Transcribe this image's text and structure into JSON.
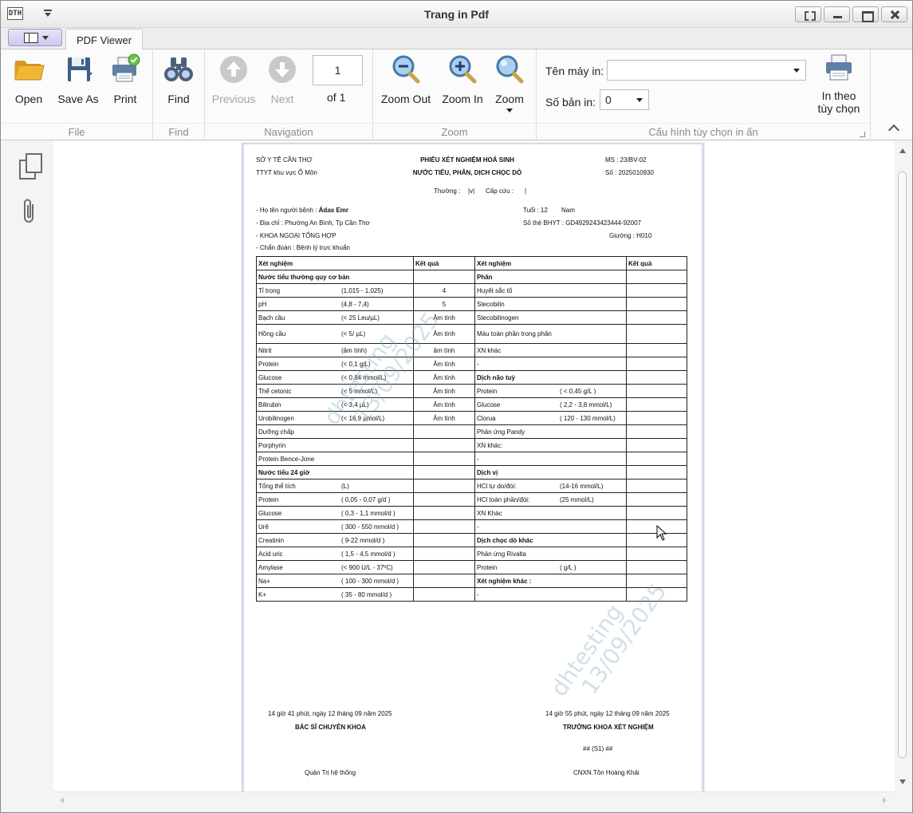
{
  "window": {
    "logo_text": "DTH",
    "title": "Trang in Pdf"
  },
  "tabs": {
    "pdf_viewer": "PDF Viewer"
  },
  "ribbon": {
    "file": {
      "label": "File",
      "open": "Open",
      "save_as": "Save As",
      "print": "Print"
    },
    "find": {
      "label": "Find",
      "find": "Find"
    },
    "navigation": {
      "label": "Navigation",
      "previous": "Previous",
      "next": "Next",
      "page_number": "1",
      "of_pages": "of 1"
    },
    "zoom": {
      "label": "Zoom",
      "zoom_out": "Zoom Out",
      "zoom_in": "Zoom In",
      "zoom": "Zoom"
    },
    "print_config": {
      "label": "Cấu hình tùy chọn in ấn",
      "printer_label": "Tên máy in:",
      "printer_value": "",
      "copies_label": "Số bản in:",
      "copies_value": "0",
      "custom_print_line1": "In theo",
      "custom_print_line2": "tùy chọn"
    }
  },
  "document": {
    "header": {
      "org1": "SỞ Y TẾ CẦN THƠ",
      "org2": "TTYT khu vực Ô Môn",
      "title1": "PHIẾU XÉT NGHIỆM HOÁ SINH",
      "title2": "NƯỚC TIỂU, PHÂN, DỊCH CHỌC DÒ",
      "ms": "MS : 23/BV-02",
      "so": "Số : 2025010930",
      "thuong": "Thường :",
      "thuong_mark": "|v|",
      "capcuu": "Cấp cứu :",
      "capcuu_mark": "|"
    },
    "patient": {
      "name_label": "- Họ tên người bệnh :",
      "name": "Ádas Emr",
      "age": "Tuổi : 12",
      "sex": "Nam",
      "address": "- Địa chỉ : Phường An Bình, Tp Cần Thơ",
      "insurance": "Số thẻ BHYT : GD4929243423444-92007",
      "department": "- KHOA NGOẠI TỔNG HỢP",
      "bed": "Giường : H010",
      "diagnosis": "- Chẩn đoán : Bệnh lý trực khuẩn"
    },
    "table": {
      "headers": [
        "Xét nghiệm",
        "Kết quả",
        "Xét nghiệm",
        "Kết quả"
      ],
      "rows": [
        {
          "l_name": "Nước tiểu thường quy cơ bản",
          "l_range": "",
          "l_bold": true,
          "l_result": "",
          "r_name": "Phân",
          "r_range": "",
          "r_bold": true,
          "r_result": ""
        },
        {
          "l_name": "Tỉ trọng",
          "l_range": "(1,015 - 1,025)",
          "l_result": "4",
          "r_name": "Huyết sắc tố",
          "r_range": "",
          "r_result": ""
        },
        {
          "l_name": "pH",
          "l_range": "(4,8 - 7,4)",
          "l_result": "5",
          "r_name": "Stecobilin",
          "r_range": "",
          "r_result": ""
        },
        {
          "l_name": "Bạch cầu",
          "l_range": "(< 25 Leu/µL)",
          "l_result": "Âm tính",
          "r_name": "Stecobilinogen",
          "r_range": "",
          "r_result": ""
        },
        {
          "l_name": "Hồng cầu",
          "l_range": "(< 5/ µL)",
          "l_result": "Âm tính",
          "r_name": "Máu toàn phần trong phân",
          "r_range": "",
          "r_result": "",
          "tall": true
        },
        {
          "l_name": "Nitrit",
          "l_range": "(âm tính)",
          "l_result": "âm tính",
          "r_name": "XN khác",
          "r_range": "",
          "r_result": ""
        },
        {
          "l_name": "Protein",
          "l_range": "(< 0,1 g/L)",
          "l_result": "Âm tính",
          "r_name": "-",
          "r_range": "",
          "r_result": ""
        },
        {
          "l_name": "Glucose",
          "l_range": "(< 0,84 mmol/L)",
          "l_result": "Âm tính",
          "r_name": "Dịch não tuỷ",
          "r_range": "",
          "r_bold": true,
          "r_result": ""
        },
        {
          "l_name": "Thể cetonic",
          "l_range": "(< 5 mmol/L)",
          "l_result": "Âm tính",
          "r_name": "Protein",
          "r_range": "( < 0,45 g/L )",
          "r_result": ""
        },
        {
          "l_name": "Bilirubin",
          "l_range": "(< 3,4 µL)",
          "l_result": "Âm tính",
          "r_name": "Glucose",
          "r_range": "( 2,2 - 3,8 mmol/L)",
          "r_result": ""
        },
        {
          "l_name": "Urobilinogen",
          "l_range": "(< 16,9 µmol/L)",
          "l_result": "Âm tính",
          "r_name": "Clorua",
          "r_range": "( 120 - 130 mmol/L)",
          "r_result": ""
        },
        {
          "l_name": "Dưỡng chấp",
          "l_range": "",
          "l_result": "",
          "r_name": "Phản ứng Pandy",
          "r_range": "",
          "r_result": ""
        },
        {
          "l_name": "Porphyrin",
          "l_range": "",
          "l_result": "",
          "r_name": "XN khác:",
          "r_range": "",
          "r_result": ""
        },
        {
          "l_name": "Protein Bence-Jone",
          "l_range": "",
          "l_result": "",
          "r_name": "-",
          "r_range": "",
          "r_result": ""
        },
        {
          "l_name": "Nước tiểu 24 giờ",
          "l_range": "",
          "l_bold": true,
          "l_result": "",
          "r_name": "Dịch vị",
          "r_range": "",
          "r_bold": true,
          "r_result": ""
        },
        {
          "l_name": "Tổng thể tích",
          "l_range": "(L)",
          "l_result": "",
          "r_name": "HCl tự do/đói:",
          "r_range": "(14-16 mmol/L)",
          "r_result": ""
        },
        {
          "l_name": "Protein",
          "l_range": "( 0,05 - 0,07 g/d )",
          "l_result": "",
          "r_name": "HCl toàn phần/đói:",
          "r_range": "(25 mmol/L)",
          "r_result": ""
        },
        {
          "l_name": "Glucose",
          "l_range": "( 0,3 - 1,1 mmol/d )",
          "l_result": "",
          "r_name": "XN Khác",
          "r_range": "",
          "r_result": ""
        },
        {
          "l_name": "Urê",
          "l_range": "( 300 - 550 mmol/d )",
          "l_result": "",
          "r_name": "-",
          "r_range": "",
          "r_result": ""
        },
        {
          "l_name": "Creatinin",
          "l_range": "( 9-22 mmol/d )",
          "l_result": "",
          "r_name": "Dịch chọc dò khác",
          "r_range": "",
          "r_bold": true,
          "r_result": ""
        },
        {
          "l_name": "Acid uric",
          "l_range": "( 1,5 - 4,5 mmol/d )",
          "l_result": "",
          "r_name": "Phản ứng Rivalta",
          "r_range": "",
          "r_result": ""
        },
        {
          "l_name": "Amylase",
          "l_range": "(< 900 U/L - 37ºC)",
          "l_result": "",
          "r_name": "Protein",
          "r_range": "( g/L )",
          "r_result": ""
        },
        {
          "l_name": "Na+",
          "l_range": "( 100 - 300 mmol/d )",
          "l_result": "",
          "r_name": "Xét nghiệm khác :",
          "r_range": "",
          "r_bold": true,
          "r_result": ""
        },
        {
          "l_name": "K+",
          "l_range": "( 35 - 80 mmol/d )",
          "l_result": "",
          "r_name": "-",
          "r_range": "",
          "r_result": ""
        }
      ]
    },
    "watermark": {
      "line1": "dhtesting",
      "line2": "13/09/2025"
    },
    "footer": {
      "left_time": "14 giờ 41 phút, ngày 12 tháng 09 năm 2025",
      "left_role": "BÁC SĨ CHUYÊN KHOA",
      "left_name": "Quản Trị hệ thống",
      "right_time": "14 giờ 55 phút, ngày 12 tháng 09 năm 2025",
      "right_role": "TRƯỞNG KHOA XÉT NGHIỆM",
      "right_sign": "## (S1) ##",
      "right_name": "CNXN.Tôn Hoàng Khải"
    }
  }
}
